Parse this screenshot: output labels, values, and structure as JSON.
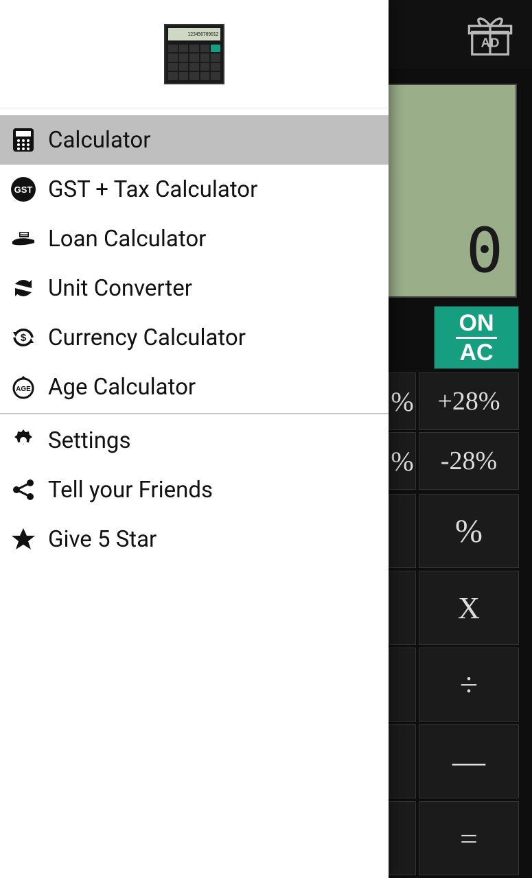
{
  "header": {
    "logo_lcd_text": "123456789012"
  },
  "menu": {
    "items": [
      {
        "label": "Calculator"
      },
      {
        "label": "GST + Tax Calculator"
      },
      {
        "label": "Loan Calculator"
      },
      {
        "label": "Unit Converter"
      },
      {
        "label": "Currency Calculator"
      },
      {
        "label": "Age Calculator"
      }
    ],
    "secondary": [
      {
        "label": "Settings"
      },
      {
        "label": "Tell your Friends"
      },
      {
        "label": "Give 5 Star"
      }
    ]
  },
  "calc": {
    "ad_label": "AD",
    "display": "0",
    "on_top": "ON",
    "on_bot": "AC",
    "btns": {
      "plus28": "+28%",
      "minus28": "-28%",
      "pct18_partial": "%",
      "pct": "%",
      "mul": "X",
      "div": "÷",
      "minus": "—",
      "eq": "="
    }
  }
}
